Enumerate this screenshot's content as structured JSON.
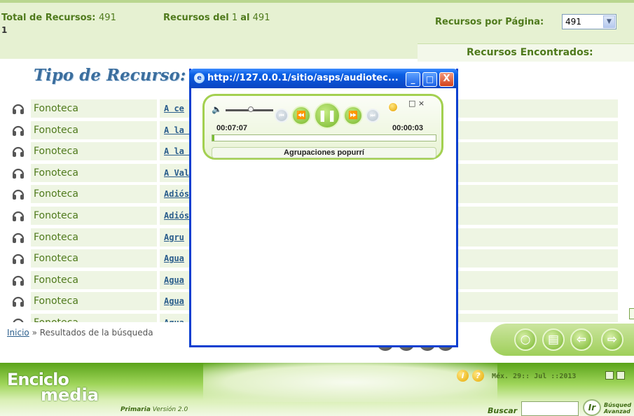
{
  "header": {
    "total_label": "Total de Recursos:",
    "total_value": "491",
    "total_line2": "1",
    "range_label": "Recursos del",
    "range_from": "1",
    "range_mid": "al",
    "range_to": "491",
    "per_page_label": "Recursos por Página:",
    "per_page_value": "491",
    "found_label": "Recursos Encontrados:"
  },
  "list": {
    "title": "Tipo de Recurso:",
    "rows": [
      {
        "category": "Fonoteca",
        "title": "A ce"
      },
      {
        "category": "Fonoteca",
        "title": "A la l"
      },
      {
        "category": "Fonoteca",
        "title": "A la c"
      },
      {
        "category": "Fonoteca",
        "title": "A Val"
      },
      {
        "category": "Fonoteca",
        "title": "Adiós"
      },
      {
        "category": "Fonoteca",
        "title": "Adiós"
      },
      {
        "category": "Fonoteca",
        "title": "Agru"
      },
      {
        "category": "Fonoteca",
        "title": "Agua"
      },
      {
        "category": "Fonoteca",
        "title": "Agua"
      },
      {
        "category": "Fonoteca",
        "title": "Agua"
      },
      {
        "category": "Fonoteca",
        "title": "Agua"
      }
    ]
  },
  "breadcrumb": {
    "home": "Inicio",
    "separator": "»",
    "current": "Resultados de la búsqueda"
  },
  "popup": {
    "title": "http://127.0.0.1/sitio/asps/audiotec...",
    "minimize": "_",
    "maximize": "□",
    "close": "X",
    "player": {
      "elapsed": "00:07:07",
      "remaining": "00:00:03",
      "progress": 0.01,
      "track": "Agrupaciones popurrí",
      "mini_controls": "□ ×"
    }
  },
  "footer": {
    "logo_line1": "Enciclo",
    "logo_line2": "media",
    "edition_label": "Primaria",
    "edition_version": "Versión 2.0",
    "date": "Méx. 29:: Jul ::2013",
    "search_label": "Buscar",
    "search_value": "",
    "go_button": "Ir",
    "advanced_line1": "Búsqued",
    "advanced_line2": "Avanzad"
  },
  "colors": {
    "accent_green": "#4f7a1c",
    "link_blue": "#2b5e8c",
    "popup_titlebar": "#0a4fd0"
  }
}
